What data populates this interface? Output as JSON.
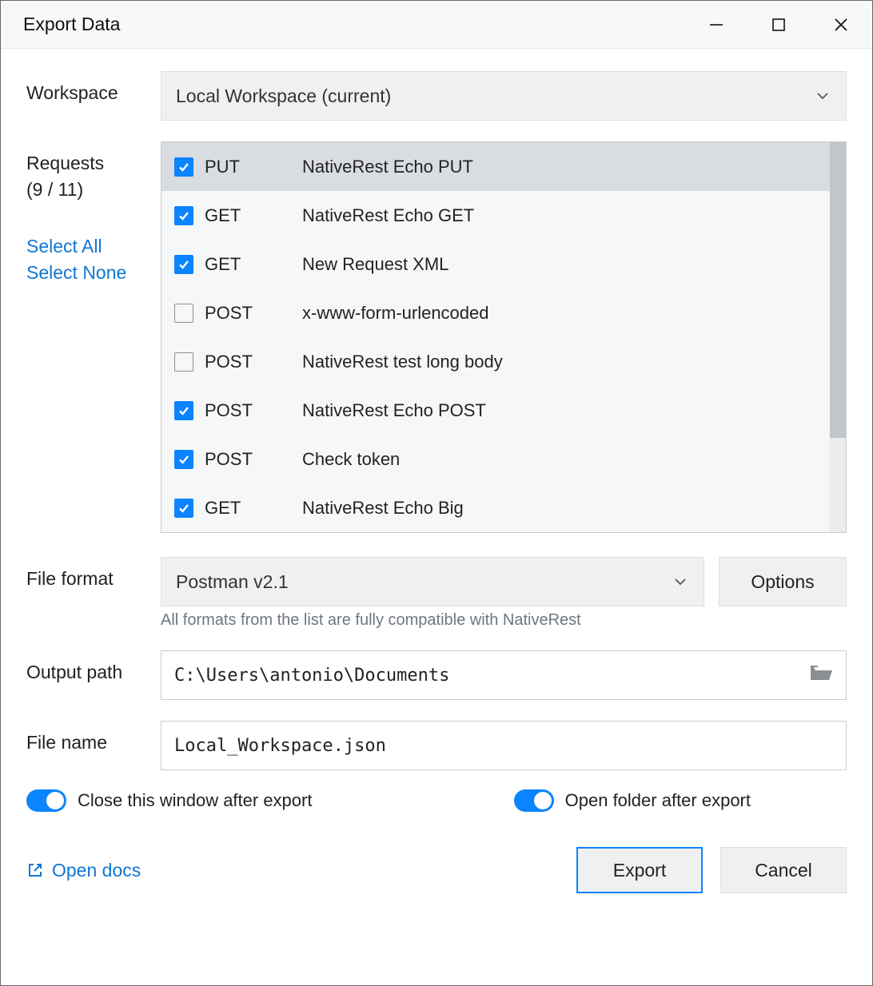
{
  "title": "Export Data",
  "workspace": {
    "label": "Workspace",
    "value": "Local Workspace (current)"
  },
  "requests": {
    "label": "Requests",
    "counts": "(9 / 11)",
    "select_all": "Select All",
    "select_none": "Select None",
    "items": [
      {
        "checked": true,
        "method": "PUT",
        "name": "NativeRest Echo PUT",
        "selected": true
      },
      {
        "checked": true,
        "method": "GET",
        "name": "NativeRest Echo GET",
        "selected": false
      },
      {
        "checked": true,
        "method": "GET",
        "name": "New Request XML",
        "selected": false
      },
      {
        "checked": false,
        "method": "POST",
        "name": "x-www-form-urlencoded",
        "selected": false
      },
      {
        "checked": false,
        "method": "POST",
        "name": "NativeRest test long body",
        "selected": false
      },
      {
        "checked": true,
        "method": "POST",
        "name": "NativeRest Echo POST",
        "selected": false
      },
      {
        "checked": true,
        "method": "POST",
        "name": "Check token",
        "selected": false
      },
      {
        "checked": true,
        "method": "GET",
        "name": "NativeRest Echo Big",
        "selected": false
      }
    ]
  },
  "format": {
    "label": "File format",
    "value": "Postman v2.1",
    "options_btn": "Options",
    "hint": "All formats from the list are fully compatible with NativeRest"
  },
  "output_path": {
    "label": "Output path",
    "value": "C:\\Users\\antonio\\Documents"
  },
  "file_name": {
    "label": "File name",
    "value": "Local_Workspace.json"
  },
  "toggles": {
    "close_after": {
      "on": true,
      "label": "Close this window after export"
    },
    "open_folder": {
      "on": true,
      "label": "Open folder after export"
    }
  },
  "footer": {
    "open_docs": "Open docs",
    "export": "Export",
    "cancel": "Cancel"
  }
}
